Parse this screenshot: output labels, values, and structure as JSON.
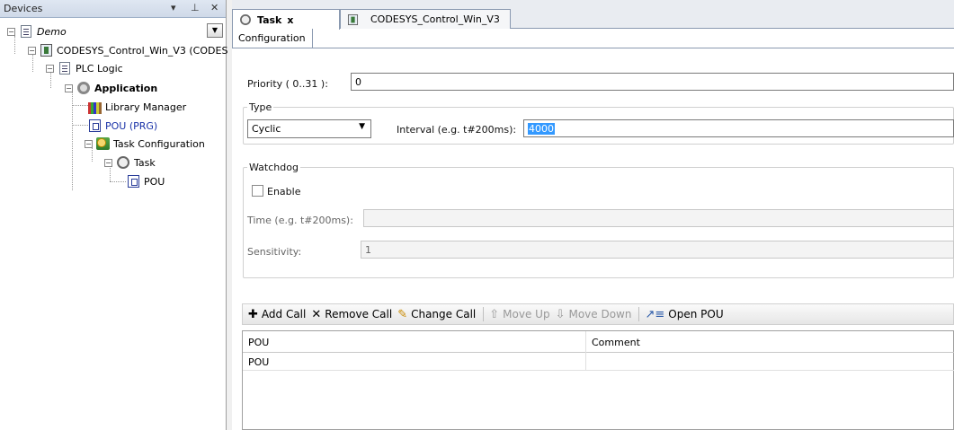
{
  "devices_panel": {
    "title": "Devices",
    "pin_glyph": "▾  ⊥",
    "close_glyph": "✕",
    "tree": {
      "demo": "Demo",
      "controller": "CODESYS_Control_Win_V3 (CODES",
      "plc_logic": "PLC Logic",
      "application": "Application",
      "library_manager": "Library Manager",
      "pou_prg": "POU (PRG)",
      "task_configuration": "Task Configuration",
      "task": "Task",
      "task_pou": "POU"
    }
  },
  "tabs": {
    "task_tab": "Task",
    "task_tab_close": "x",
    "controller_tab": "CODESYS_Control_Win_V3"
  },
  "config": {
    "tab_label": "Configuration",
    "priority_label": "Priority ( 0..31 ):",
    "priority_value": "0",
    "type_group_label": "Type",
    "type_value": "Cyclic",
    "interval_label": "Interval (e.g. t#200ms):",
    "interval_value": "4000",
    "watchdog_group_label": "Watchdog",
    "enable_label": "Enable",
    "time_label": "Time (e.g. t#200ms):",
    "time_value": "",
    "sensitivity_label": "Sensitivity:",
    "sensitivity_value": "1"
  },
  "toolbar": {
    "add_call": "Add Call",
    "remove_call": "Remove Call",
    "change_call": "Change Call",
    "move_up": "Move Up",
    "move_down": "Move Down",
    "open_pou": "Open POU"
  },
  "grid": {
    "columns": [
      "POU",
      "Comment"
    ],
    "rows": [
      [
        "POU",
        ""
      ]
    ]
  },
  "colors": {
    "selection": "#3399ff",
    "link_blue": "#1a33a8"
  }
}
